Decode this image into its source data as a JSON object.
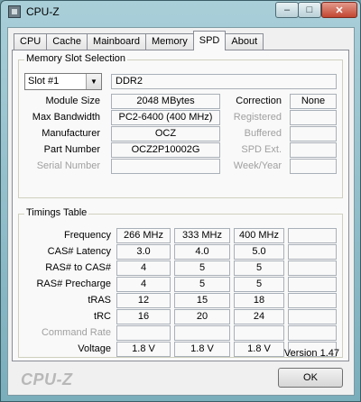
{
  "window": {
    "title": "CPU-Z",
    "min_glyph": "–",
    "max_glyph": "□",
    "close_glyph": "✕",
    "icon": "cpu-z-app-icon"
  },
  "tabs": [
    {
      "label": "CPU",
      "active": false
    },
    {
      "label": "Cache",
      "active": false
    },
    {
      "label": "Mainboard",
      "active": false
    },
    {
      "label": "Memory",
      "active": false
    },
    {
      "label": "SPD",
      "active": true
    },
    {
      "label": "About",
      "active": false
    }
  ],
  "memory_slot": {
    "group_title": "Memory Slot Selection",
    "slot_value": "Slot #1",
    "memory_type": "DDR2",
    "module_size_label": "Module Size",
    "module_size": "2048 MBytes",
    "max_bandwidth_label": "Max Bandwidth",
    "max_bandwidth": "PC2-6400 (400 MHz)",
    "manufacturer_label": "Manufacturer",
    "manufacturer": "OCZ",
    "part_number_label": "Part Number",
    "part_number": "OCZ2P10002G",
    "serial_number_label": "Serial Number",
    "serial_number": "",
    "correction_label": "Correction",
    "correction": "None",
    "registered_label": "Registered",
    "registered": "",
    "buffered_label": "Buffered",
    "buffered": "",
    "spd_ext_label": "SPD Ext.",
    "spd_ext": "",
    "week_year_label": "Week/Year",
    "week_year": ""
  },
  "timings": {
    "group_title": "Timings Table",
    "rows": [
      {
        "label": "Frequency",
        "values": [
          "266 MHz",
          "333 MHz",
          "400 MHz",
          ""
        ],
        "disabled": false
      },
      {
        "label": "CAS# Latency",
        "values": [
          "3.0",
          "4.0",
          "5.0",
          ""
        ],
        "disabled": false
      },
      {
        "label": "RAS# to CAS#",
        "values": [
          "4",
          "5",
          "5",
          ""
        ],
        "disabled": false
      },
      {
        "label": "RAS# Precharge",
        "values": [
          "4",
          "5",
          "5",
          ""
        ],
        "disabled": false
      },
      {
        "label": "tRAS",
        "values": [
          "12",
          "15",
          "18",
          ""
        ],
        "disabled": false
      },
      {
        "label": "tRC",
        "values": [
          "16",
          "20",
          "24",
          ""
        ],
        "disabled": false
      },
      {
        "label": "Command Rate",
        "values": [
          "",
          "",
          "",
          ""
        ],
        "disabled": true
      },
      {
        "label": "Voltage",
        "values": [
          "1.8 V",
          "1.8 V",
          "1.8 V",
          ""
        ],
        "disabled": false
      }
    ]
  },
  "footer": {
    "version": "Version 1.47",
    "brand": "CPU-Z",
    "ok_label": "OK"
  }
}
